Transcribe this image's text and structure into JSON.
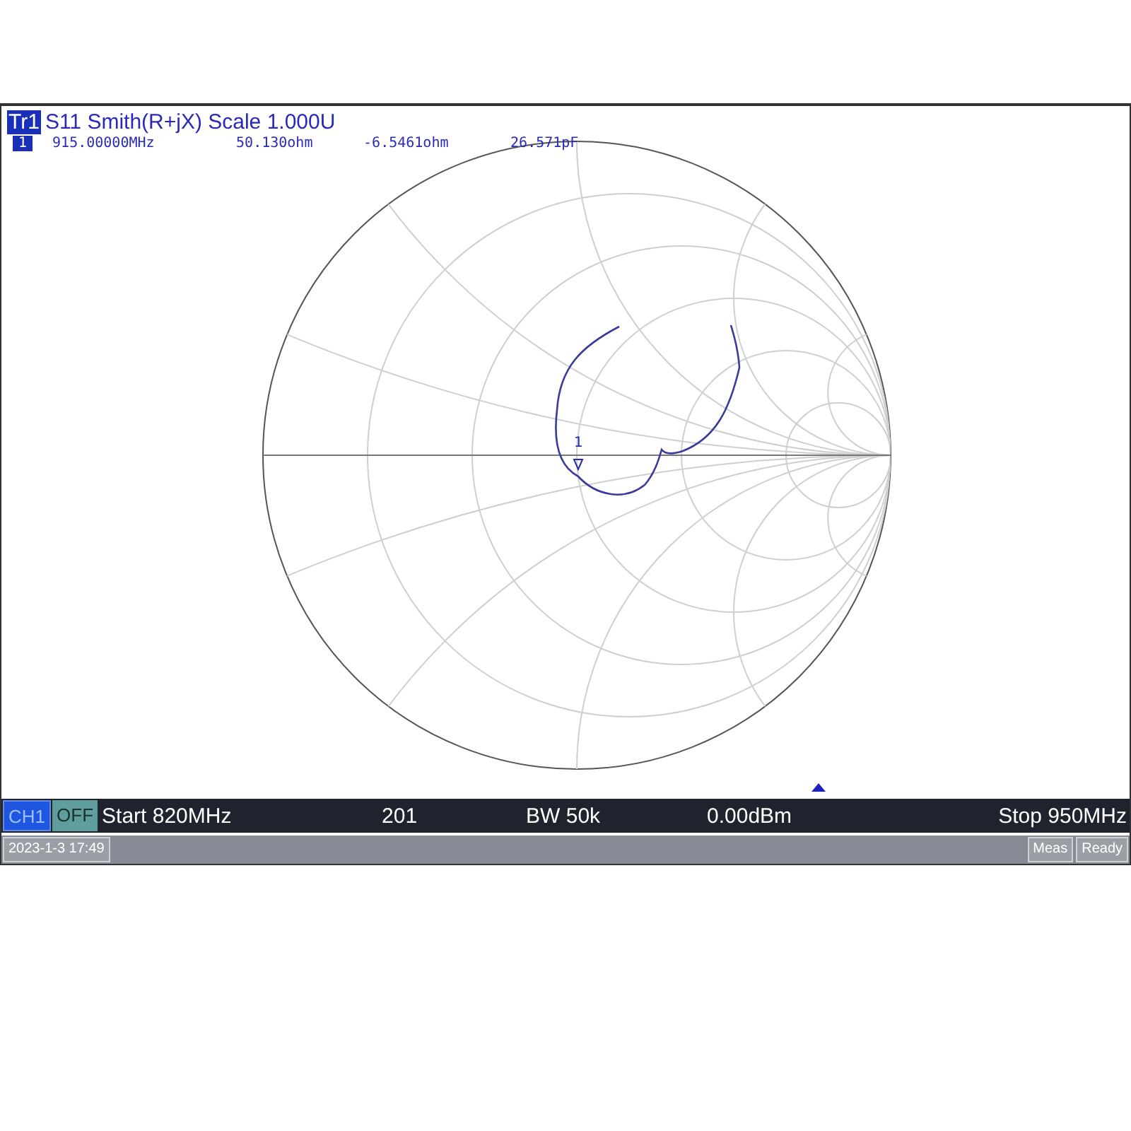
{
  "trace": {
    "label": "Tr1",
    "title": "S11 Smith(R+jX) Scale 1.000U"
  },
  "marker_readout": {
    "number": "1",
    "frequency": "915.00000MHz",
    "resistance": "50.130ohm",
    "reactance": "-6.5461ohm",
    "capacitance": "26.571pF"
  },
  "chart": {
    "marker_label": "1"
  },
  "channel_bar": {
    "channel": "CH1",
    "power_state": "OFF",
    "start": "Start 820MHz",
    "points": "201",
    "bandwidth": "BW 50k",
    "power": "0.00dBm",
    "stop": "Stop 950MHz"
  },
  "status_bar": {
    "datetime": "2023-1-3 17:49",
    "buttons": [
      "Meas",
      "Ready"
    ]
  }
}
